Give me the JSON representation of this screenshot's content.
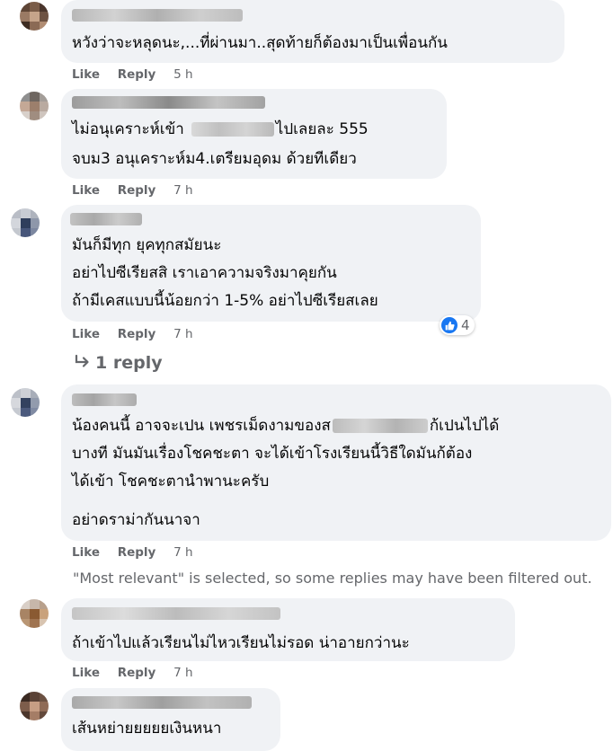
{
  "actions": {
    "like_label": "Like",
    "reply_label": "Reply"
  },
  "comments": [
    {
      "text_lines": [
        "หวังว่าจะหลุดนะ,...ที่ผ่านมา..สุดท้ายก็ต้องมาเป็นเพื่อนกัน"
      ],
      "time": "5 h"
    },
    {
      "text_lines": [
        "ไม่อนุเคราะห์เข้า",
        "ไปเลยละ 555",
        "จบม3 อนุเคราะห์ม4.เตรียมอุดม ด้วยทีเดียว"
      ],
      "time": "7 h"
    },
    {
      "text_lines": [
        "มันก็มีทุก ยุคทุกสมัยนะ",
        "อย่าไปซีเรียสสิ เราเอาความจริงมาคุยกัน",
        "ถ้ามีเคสแบบนี้น้อยกว่า 1-5% อย่าไปซีเรียสเลย"
      ],
      "time": "7 h",
      "reaction_count": "4"
    },
    {
      "text_lines": [
        "น้องคนนี้ อาจจะเปน เพชรเม็ดงามของส",
        "ก้เปนไปได้",
        "บางที มันมันเรื่องโชคชะตา จะได้เข้าโรงเรียนนี้วิธีใดมันก้ต้อง",
        "ได้เข้า โชคชะตานำพานะครับ",
        "อย่าดราม่ากันนาจา"
      ],
      "time": "7 h"
    },
    {
      "text_lines": [
        "ถ้าเข้าไปแล้วเรียนไม่ไหวเรียนไม่รอด น่าอายกว่านะ"
      ],
      "time": "7 h"
    },
    {
      "text_lines": [
        "เส้นหย่ายยยยยเงินหนา"
      ]
    }
  ],
  "replies_link": {
    "icon": "reply-arrow-icon",
    "label": "1 reply"
  },
  "filter_notice": "\"Most relevant\" is selected, so some replies may have been filtered out.",
  "colors": {
    "bubble": "#f0f2f5",
    "secondary_text": "#65676b",
    "like_blue": "#1877f2"
  }
}
